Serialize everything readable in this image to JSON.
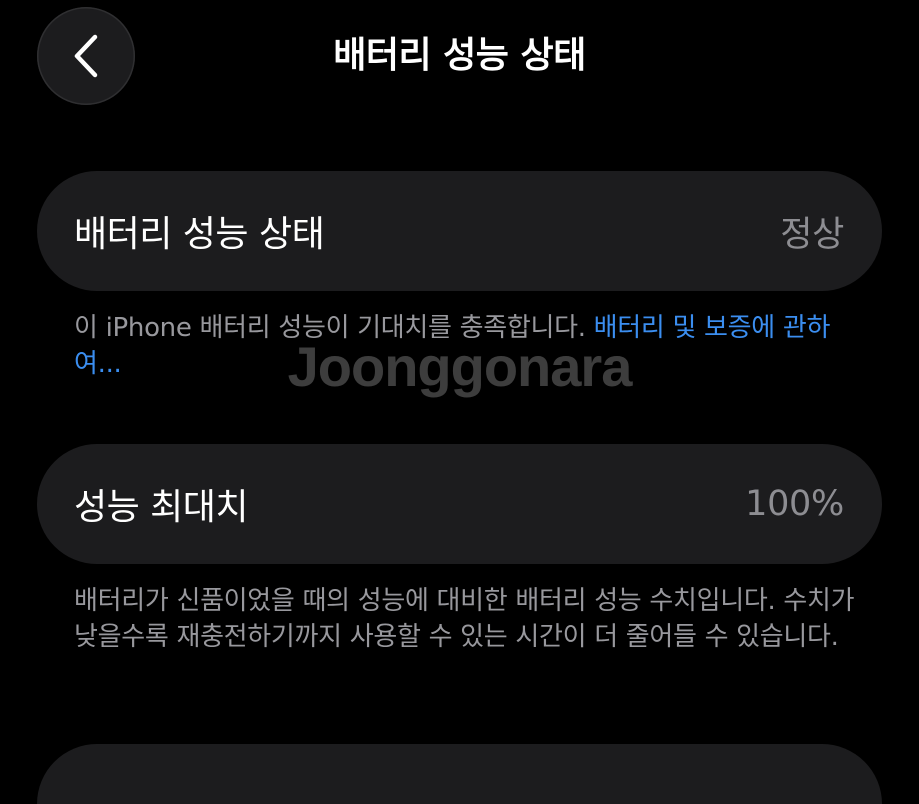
{
  "nav": {
    "title": "배터리 성능 상태",
    "back_icon": "chevron-left-icon"
  },
  "battery_health": {
    "label": "배터리 성능 상태",
    "value": "정상",
    "description": "이 iPhone 배터리 성능이 기대치를 충족합니다. ",
    "link": "배터리 및 보증에 관하여..."
  },
  "maximum_capacity": {
    "label": "성능 최대치",
    "value": "100%",
    "description": "배터리가 신품이었을 때의 성능에 대비한 배터리 성능 수치입니다. 수치가 낮을수록 재충전하기까지 사용할 수 있는 시간이 더 줄어들 수 있습니다."
  },
  "watermark": {
    "text": "Joonggonara"
  },
  "colors": {
    "background": "#000000",
    "card": "#1c1c1e",
    "secondary_text": "#98989d",
    "link": "#3b8ef0"
  }
}
